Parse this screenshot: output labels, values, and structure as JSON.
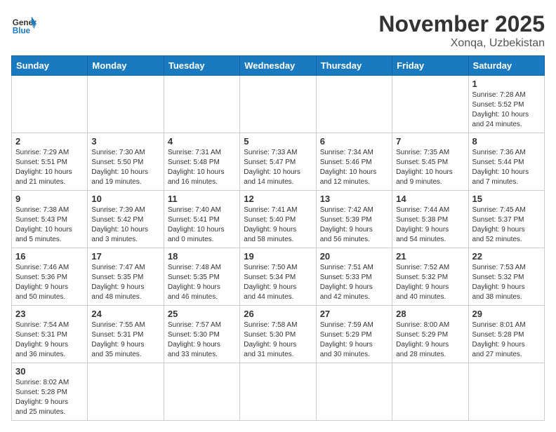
{
  "header": {
    "logo_general": "General",
    "logo_blue": "Blue",
    "month_title": "November 2025",
    "location": "Xonqa, Uzbekistan"
  },
  "weekdays": [
    "Sunday",
    "Monday",
    "Tuesday",
    "Wednesday",
    "Thursday",
    "Friday",
    "Saturday"
  ],
  "weeks": [
    [
      {
        "day": "",
        "info": ""
      },
      {
        "day": "",
        "info": ""
      },
      {
        "day": "",
        "info": ""
      },
      {
        "day": "",
        "info": ""
      },
      {
        "day": "",
        "info": ""
      },
      {
        "day": "",
        "info": ""
      },
      {
        "day": "1",
        "info": "Sunrise: 7:28 AM\nSunset: 5:52 PM\nDaylight: 10 hours\nand 24 minutes."
      }
    ],
    [
      {
        "day": "2",
        "info": "Sunrise: 7:29 AM\nSunset: 5:51 PM\nDaylight: 10 hours\nand 21 minutes."
      },
      {
        "day": "3",
        "info": "Sunrise: 7:30 AM\nSunset: 5:50 PM\nDaylight: 10 hours\nand 19 minutes."
      },
      {
        "day": "4",
        "info": "Sunrise: 7:31 AM\nSunset: 5:48 PM\nDaylight: 10 hours\nand 16 minutes."
      },
      {
        "day": "5",
        "info": "Sunrise: 7:33 AM\nSunset: 5:47 PM\nDaylight: 10 hours\nand 14 minutes."
      },
      {
        "day": "6",
        "info": "Sunrise: 7:34 AM\nSunset: 5:46 PM\nDaylight: 10 hours\nand 12 minutes."
      },
      {
        "day": "7",
        "info": "Sunrise: 7:35 AM\nSunset: 5:45 PM\nDaylight: 10 hours\nand 9 minutes."
      },
      {
        "day": "8",
        "info": "Sunrise: 7:36 AM\nSunset: 5:44 PM\nDaylight: 10 hours\nand 7 minutes."
      }
    ],
    [
      {
        "day": "9",
        "info": "Sunrise: 7:38 AM\nSunset: 5:43 PM\nDaylight: 10 hours\nand 5 minutes."
      },
      {
        "day": "10",
        "info": "Sunrise: 7:39 AM\nSunset: 5:42 PM\nDaylight: 10 hours\nand 3 minutes."
      },
      {
        "day": "11",
        "info": "Sunrise: 7:40 AM\nSunset: 5:41 PM\nDaylight: 10 hours\nand 0 minutes."
      },
      {
        "day": "12",
        "info": "Sunrise: 7:41 AM\nSunset: 5:40 PM\nDaylight: 9 hours\nand 58 minutes."
      },
      {
        "day": "13",
        "info": "Sunrise: 7:42 AM\nSunset: 5:39 PM\nDaylight: 9 hours\nand 56 minutes."
      },
      {
        "day": "14",
        "info": "Sunrise: 7:44 AM\nSunset: 5:38 PM\nDaylight: 9 hours\nand 54 minutes."
      },
      {
        "day": "15",
        "info": "Sunrise: 7:45 AM\nSunset: 5:37 PM\nDaylight: 9 hours\nand 52 minutes."
      }
    ],
    [
      {
        "day": "16",
        "info": "Sunrise: 7:46 AM\nSunset: 5:36 PM\nDaylight: 9 hours\nand 50 minutes."
      },
      {
        "day": "17",
        "info": "Sunrise: 7:47 AM\nSunset: 5:35 PM\nDaylight: 9 hours\nand 48 minutes."
      },
      {
        "day": "18",
        "info": "Sunrise: 7:48 AM\nSunset: 5:35 PM\nDaylight: 9 hours\nand 46 minutes."
      },
      {
        "day": "19",
        "info": "Sunrise: 7:50 AM\nSunset: 5:34 PM\nDaylight: 9 hours\nand 44 minutes."
      },
      {
        "day": "20",
        "info": "Sunrise: 7:51 AM\nSunset: 5:33 PM\nDaylight: 9 hours\nand 42 minutes."
      },
      {
        "day": "21",
        "info": "Sunrise: 7:52 AM\nSunset: 5:32 PM\nDaylight: 9 hours\nand 40 minutes."
      },
      {
        "day": "22",
        "info": "Sunrise: 7:53 AM\nSunset: 5:32 PM\nDaylight: 9 hours\nand 38 minutes."
      }
    ],
    [
      {
        "day": "23",
        "info": "Sunrise: 7:54 AM\nSunset: 5:31 PM\nDaylight: 9 hours\nand 36 minutes."
      },
      {
        "day": "24",
        "info": "Sunrise: 7:55 AM\nSunset: 5:31 PM\nDaylight: 9 hours\nand 35 minutes."
      },
      {
        "day": "25",
        "info": "Sunrise: 7:57 AM\nSunset: 5:30 PM\nDaylight: 9 hours\nand 33 minutes."
      },
      {
        "day": "26",
        "info": "Sunrise: 7:58 AM\nSunset: 5:30 PM\nDaylight: 9 hours\nand 31 minutes."
      },
      {
        "day": "27",
        "info": "Sunrise: 7:59 AM\nSunset: 5:29 PM\nDaylight: 9 hours\nand 30 minutes."
      },
      {
        "day": "28",
        "info": "Sunrise: 8:00 AM\nSunset: 5:29 PM\nDaylight: 9 hours\nand 28 minutes."
      },
      {
        "day": "29",
        "info": "Sunrise: 8:01 AM\nSunset: 5:28 PM\nDaylight: 9 hours\nand 27 minutes."
      }
    ],
    [
      {
        "day": "30",
        "info": "Sunrise: 8:02 AM\nSunset: 5:28 PM\nDaylight: 9 hours\nand 25 minutes."
      },
      {
        "day": "",
        "info": ""
      },
      {
        "day": "",
        "info": ""
      },
      {
        "day": "",
        "info": ""
      },
      {
        "day": "",
        "info": ""
      },
      {
        "day": "",
        "info": ""
      },
      {
        "day": "",
        "info": ""
      }
    ]
  ]
}
